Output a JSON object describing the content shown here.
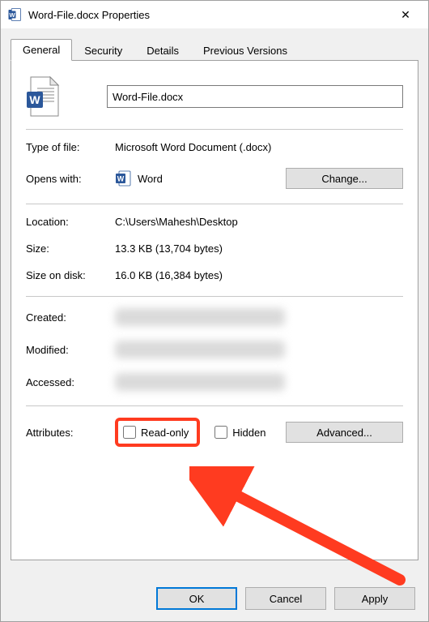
{
  "window": {
    "title": "Word-File.docx Properties",
    "close_icon": "✕"
  },
  "tabs": {
    "general": "General",
    "security": "Security",
    "details": "Details",
    "previous_versions": "Previous Versions"
  },
  "filename": "Word-File.docx",
  "fields": {
    "type_label": "Type of file:",
    "type_value": "Microsoft Word Document (.docx)",
    "opens_label": "Opens with:",
    "opens_value": "Word",
    "change_button": "Change...",
    "location_label": "Location:",
    "location_value": "C:\\Users\\Mahesh\\Desktop",
    "size_label": "Size:",
    "size_value": "13.3 KB (13,704 bytes)",
    "size_on_disk_label": "Size on disk:",
    "size_on_disk_value": "16.0 KB (16,384 bytes)",
    "created_label": "Created:",
    "modified_label": "Modified:",
    "accessed_label": "Accessed:",
    "attributes_label": "Attributes:",
    "readonly_label": "Read-only",
    "hidden_label": "Hidden",
    "advanced_button": "Advanced..."
  },
  "buttons": {
    "ok": "OK",
    "cancel": "Cancel",
    "apply": "Apply"
  },
  "icons": {
    "word_blue": "#2B579A",
    "word_dark": "#185ABD"
  }
}
